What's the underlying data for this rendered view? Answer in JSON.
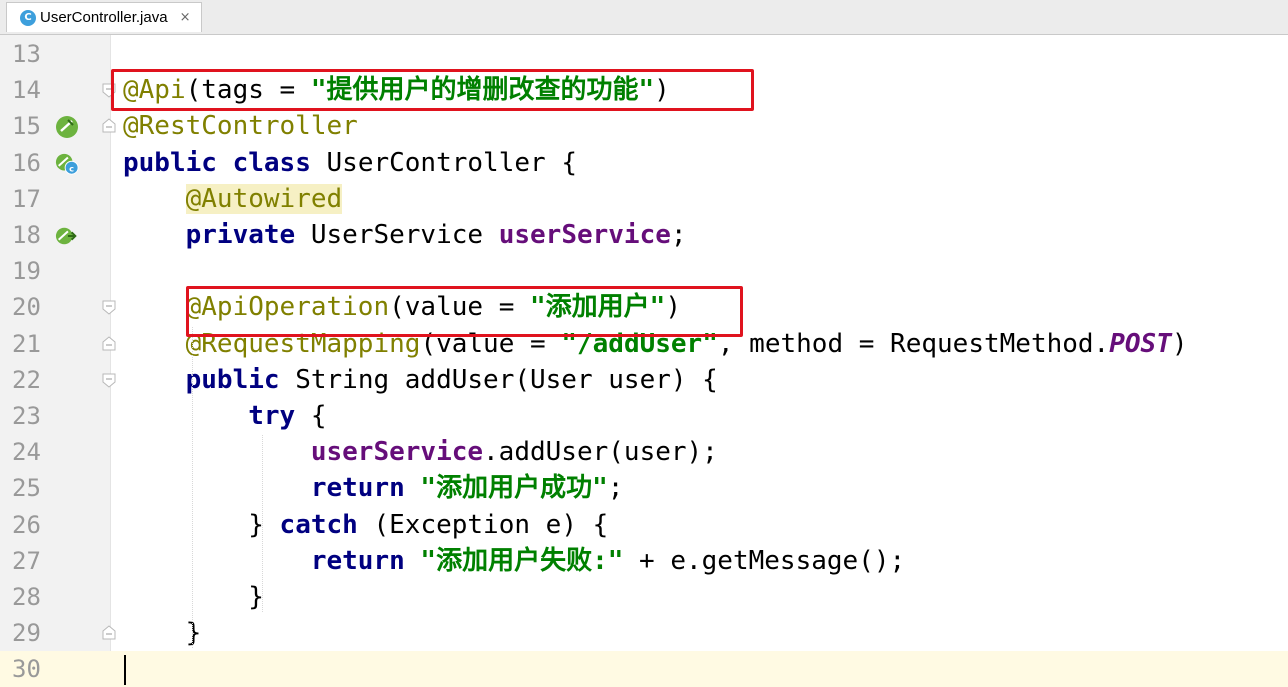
{
  "tab": {
    "icon": "class-c-icon",
    "title": "UserController.java",
    "close_glyph": "×"
  },
  "editor": {
    "lines": [
      {
        "no": "13",
        "code": []
      },
      {
        "no": "14",
        "code": [
          {
            "t": "@Api",
            "c": "an"
          },
          {
            "t": "(tags = ",
            "c": ""
          },
          {
            "t": "\"提供用户的增删改查的功能\"",
            "c": "st"
          },
          {
            "t": ")",
            "c": ""
          }
        ]
      },
      {
        "no": "15",
        "code": [
          {
            "t": "@RestController",
            "c": "an"
          }
        ]
      },
      {
        "no": "16",
        "code": [
          {
            "t": "public",
            "c": "kw"
          },
          {
            "t": " ",
            "c": ""
          },
          {
            "t": "class",
            "c": "kw"
          },
          {
            "t": " UserController {",
            "c": ""
          }
        ]
      },
      {
        "no": "17",
        "code": [
          {
            "t": "    ",
            "c": ""
          },
          {
            "t": "@Autowired",
            "c": "an hl-ann"
          }
        ]
      },
      {
        "no": "18",
        "code": [
          {
            "t": "    ",
            "c": ""
          },
          {
            "t": "private",
            "c": "kw"
          },
          {
            "t": " UserService ",
            "c": ""
          },
          {
            "t": "userService",
            "c": "fd"
          },
          {
            "t": ";",
            "c": ""
          }
        ]
      },
      {
        "no": "19",
        "code": []
      },
      {
        "no": "20",
        "code": [
          {
            "t": "    ",
            "c": ""
          },
          {
            "t": "@ApiOperation",
            "c": "an"
          },
          {
            "t": "(value = ",
            "c": ""
          },
          {
            "t": "\"添加用户\"",
            "c": "st"
          },
          {
            "t": ")",
            "c": ""
          }
        ]
      },
      {
        "no": "21",
        "code": [
          {
            "t": "    ",
            "c": ""
          },
          {
            "t": "@RequestMapping",
            "c": "an"
          },
          {
            "t": "(value = ",
            "c": ""
          },
          {
            "t": "\"/addUser\"",
            "c": "st"
          },
          {
            "t": ", method = RequestMethod.",
            "c": ""
          },
          {
            "t": "POST",
            "c": "ps"
          },
          {
            "t": ")",
            "c": ""
          }
        ]
      },
      {
        "no": "22",
        "code": [
          {
            "t": "    ",
            "c": ""
          },
          {
            "t": "public",
            "c": "kw"
          },
          {
            "t": " String addUser(User user) {",
            "c": ""
          }
        ]
      },
      {
        "no": "23",
        "code": [
          {
            "t": "        ",
            "c": ""
          },
          {
            "t": "try",
            "c": "kw"
          },
          {
            "t": " {",
            "c": ""
          }
        ]
      },
      {
        "no": "24",
        "code": [
          {
            "t": "            ",
            "c": ""
          },
          {
            "t": "userService",
            "c": "fd"
          },
          {
            "t": ".addUser(user);",
            "c": ""
          }
        ]
      },
      {
        "no": "25",
        "code": [
          {
            "t": "            ",
            "c": ""
          },
          {
            "t": "return",
            "c": "kw"
          },
          {
            "t": " ",
            "c": ""
          },
          {
            "t": "\"添加用户成功\"",
            "c": "st"
          },
          {
            "t": ";",
            "c": ""
          }
        ]
      },
      {
        "no": "26",
        "code": [
          {
            "t": "        } ",
            "c": ""
          },
          {
            "t": "catch",
            "c": "kw"
          },
          {
            "t": " (Exception e) {",
            "c": ""
          }
        ]
      },
      {
        "no": "27",
        "code": [
          {
            "t": "            ",
            "c": ""
          },
          {
            "t": "return",
            "c": "kw"
          },
          {
            "t": " ",
            "c": ""
          },
          {
            "t": "\"添加用户失败:\"",
            "c": "st"
          },
          {
            "t": " + e.getMessage();",
            "c": ""
          }
        ]
      },
      {
        "no": "28",
        "code": [
          {
            "t": "        }",
            "c": ""
          }
        ]
      },
      {
        "no": "29",
        "code": [
          {
            "t": "    }",
            "c": ""
          }
        ]
      },
      {
        "no": "30",
        "code": []
      }
    ],
    "gutter_icons": {
      "15": "spring-bean-icon",
      "16": "spring-class-icon",
      "18": "autowired-navigate-icon"
    },
    "colors": {
      "keyword": "#000080",
      "annotation": "#808000",
      "string": "#008000",
      "field": "#660e7a",
      "highlight_box": "#e0131e",
      "current_line": "#fffae3"
    }
  }
}
